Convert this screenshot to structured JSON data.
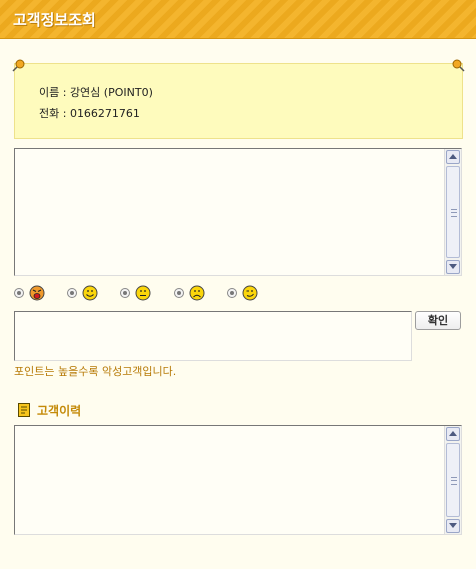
{
  "title": "고객정보조회",
  "info": {
    "name_line": "이름 : 강연심 (POINT0)",
    "phone_line": "전화 : 0166271761"
  },
  "ratings": [
    "very-angry-face-icon",
    "smile-face-icon",
    "neutral-face-icon",
    "sad-face-icon",
    "wink-face-icon"
  ],
  "confirm_label": "확인",
  "note": "포인트는 높을수록 악성고객입니다.",
  "history_label": "고객이력",
  "colors": {
    "title_bg": "#f0ad24",
    "note_text": "#b77a07",
    "info_bg": "#fefbbd"
  }
}
